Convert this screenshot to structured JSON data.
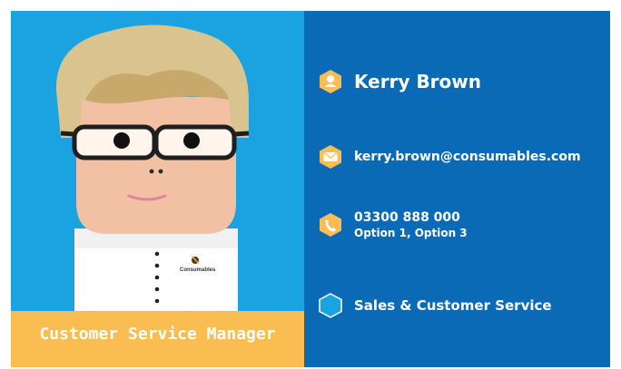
{
  "person": {
    "name": "Kerry Brown",
    "role": "Customer Service Manager"
  },
  "contact": {
    "email": "kerry.brown@consumables.com",
    "phone": "03300 888 000",
    "phone_options": "Option 1, Option 3"
  },
  "department": "Sales & Customer Service",
  "logo_text": "Consumables",
  "colors": {
    "left_background": "#1aa3e0",
    "right_background": "#0a6ab5",
    "role_banner": "#f9bd52",
    "icon_color": "#f9bd52"
  },
  "icons": [
    "person-icon",
    "envelope-icon",
    "phone-icon",
    "hexagon-icon"
  ]
}
